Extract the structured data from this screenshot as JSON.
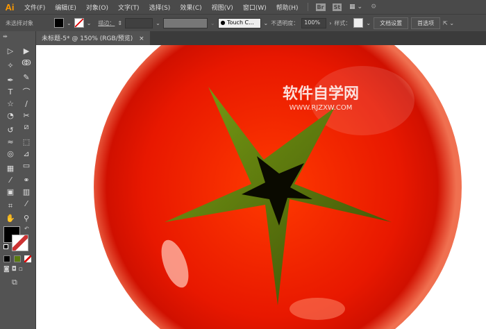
{
  "app": {
    "logo": "Ai"
  },
  "menu": [
    "文件(F)",
    "编辑(E)",
    "对象(O)",
    "文字(T)",
    "选择(S)",
    "效果(C)",
    "视图(V)",
    "窗口(W)",
    "帮助(H)"
  ],
  "app_buttons": [
    "Br",
    "St"
  ],
  "control": {
    "selection": "未选择对象",
    "stroke_label": "描边：",
    "brush": "Touch C...",
    "opacity_label": "不透明度：",
    "opacity": "100%",
    "style_label": "样式：",
    "doc_setup": "文档设置",
    "prefs": "首选项"
  },
  "tab": {
    "title": "未标题-5* @ 150% (RGB/预览)",
    "close": "×"
  },
  "watermark": {
    "cn": "软件自学网",
    "url": "WWW.RJZXW.COM"
  },
  "colors": {
    "fill": "#000000",
    "tomato": "#e81800",
    "leaf": "#6a8a10"
  },
  "tools": [
    {
      "n": "selection-tool",
      "g": "▷"
    },
    {
      "n": "direct-selection-tool",
      "g": "▶"
    },
    {
      "n": "magic-wand-tool",
      "g": "✧"
    },
    {
      "n": "lasso-tool",
      "g": "ↂ"
    },
    {
      "n": "pen-tool",
      "g": "✒"
    },
    {
      "n": "curvature-tool",
      "g": "✎"
    },
    {
      "n": "type-tool",
      "g": "T"
    },
    {
      "n": "arc-tool",
      "g": "⌒"
    },
    {
      "n": "star-tool",
      "g": "☆"
    },
    {
      "n": "paintbrush-tool",
      "g": "∕"
    },
    {
      "n": "blob-brush-tool",
      "g": "◔"
    },
    {
      "n": "scissors-tool",
      "g": "✂"
    },
    {
      "n": "rotate-tool",
      "g": "↺"
    },
    {
      "n": "scale-tool",
      "g": "⧄"
    },
    {
      "n": "warp-tool",
      "g": "≈"
    },
    {
      "n": "free-transform-tool",
      "g": "⬚"
    },
    {
      "n": "shape-builder-tool",
      "g": "◎"
    },
    {
      "n": "perspective-grid-tool",
      "g": "⊿"
    },
    {
      "n": "mesh-tool",
      "g": "▦"
    },
    {
      "n": "gradient-tool",
      "g": "▭"
    },
    {
      "n": "eyedropper-tool",
      "g": "⁄"
    },
    {
      "n": "blend-tool",
      "g": "⚭"
    },
    {
      "n": "symbol-sprayer-tool",
      "g": "▣"
    },
    {
      "n": "column-graph-tool",
      "g": "▥"
    },
    {
      "n": "artboard-tool",
      "g": "⌗"
    },
    {
      "n": "slice-tool",
      "g": "⁄"
    },
    {
      "n": "hand-tool",
      "g": "✋"
    },
    {
      "n": "zoom-tool",
      "g": "⚲"
    }
  ]
}
